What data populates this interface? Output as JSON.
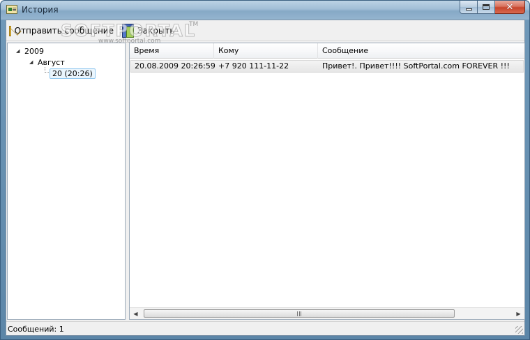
{
  "window": {
    "title": "История"
  },
  "toolbar": {
    "send_label": "Отправить сообщение",
    "close_label": "Закрыть"
  },
  "watermark": {
    "brand": "SOFTPORTAL",
    "tm": "TM",
    "site": "www.softportal.com"
  },
  "tree": {
    "year": "2009",
    "month": "Август",
    "day": "20 (20:26)"
  },
  "table": {
    "columns": [
      "Время",
      "Кому",
      "Сообщение"
    ],
    "rows": [
      [
        "20.08.2009 20:26:59",
        "+7 920 111-11-22",
        "Привет!. Привет!!!! SoftPortal.com FOREVER !!!"
      ]
    ]
  },
  "status": {
    "text": "Сообщений: 1"
  },
  "colors": {
    "selection_border": "#8fc6ef",
    "close_button": "#c7442b"
  }
}
